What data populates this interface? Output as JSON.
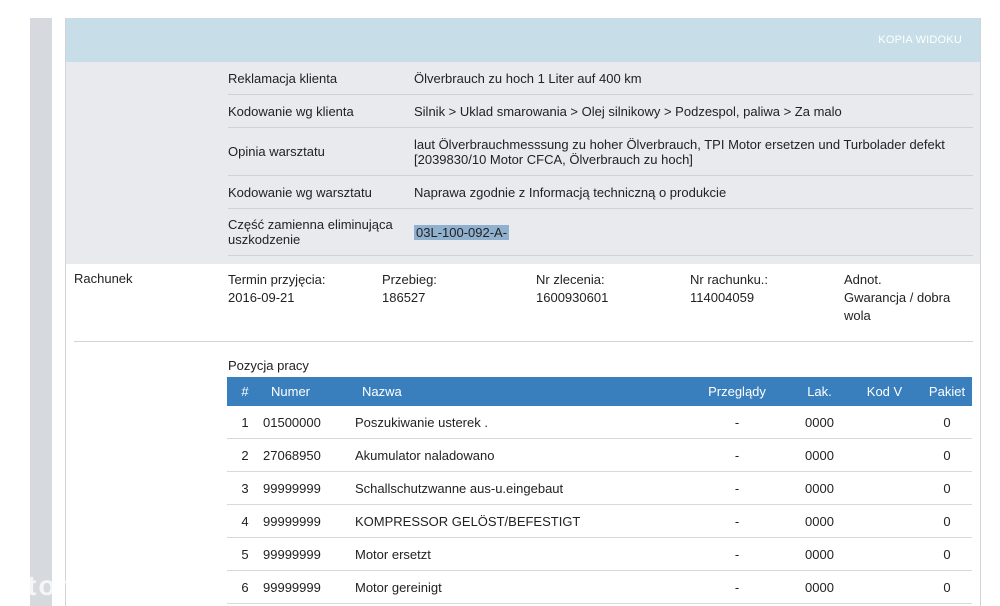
{
  "header": {
    "copy_view_label": "KOPIA WIDOKU"
  },
  "complaint": [
    {
      "label": "Reklamacja klienta",
      "value": "Ölverbrauch zu hoch 1 Liter auf 400 km"
    },
    {
      "label": "Kodowanie wg klienta",
      "value": "Silnik > Uklad smarowania > Olej silnikowy > Podzespol, paliwa > Za malo"
    },
    {
      "label": "Opinia warsztatu",
      "value": "laut Ölverbrauchmesssung zu hoher Ölverbrauch, TPI Motor ersetzen und Turbolader defekt [2039830/10 Motor CFCA, Ölverbrauch zu hoch]"
    },
    {
      "label": "Kodowanie wg warsztatu",
      "value": "Naprawa zgodnie z Informacją techniczną o produkcie"
    },
    {
      "label": "Część zamienna eliminująca uszkodzenie",
      "value": "03L-100-092-A-"
    }
  ],
  "invoice": {
    "section_label": "Rachunek",
    "fields": [
      {
        "label": "Termin przyjęcia:",
        "value": "2016-09-21"
      },
      {
        "label": "Przebieg:",
        "value": "186527"
      },
      {
        "label": "Nr zlecenia:",
        "value": "1600930601"
      },
      {
        "label": "Nr rachunku.:",
        "value": "114004059"
      },
      {
        "label": "Adnot.",
        "value": "Gwarancja / dobra wola"
      }
    ]
  },
  "work": {
    "title": "Pozycja pracy",
    "columns": [
      "#",
      "Numer",
      "Nazwa",
      "Przeglądy",
      "Lak.",
      "Kod V",
      "Pakiet"
    ],
    "rows": [
      {
        "idx": "1",
        "num": "01500000",
        "name": "Poszukiwanie usterek .",
        "prz": "-",
        "lak": "0000",
        "kod": "",
        "pak": "0"
      },
      {
        "idx": "2",
        "num": "27068950",
        "name": "Akumulator naladowano",
        "prz": "-",
        "lak": "0000",
        "kod": "",
        "pak": "0"
      },
      {
        "idx": "3",
        "num": "99999999",
        "name": "Schallschutzwanne aus-u.eingebaut",
        "prz": "-",
        "lak": "0000",
        "kod": "",
        "pak": "0"
      },
      {
        "idx": "4",
        "num": "99999999",
        "name": "KOMPRESSOR GELÖST/BEFESTIGT",
        "prz": "-",
        "lak": "0000",
        "kod": "",
        "pak": "0"
      },
      {
        "idx": "5",
        "num": "99999999",
        "name": "Motor ersetzt",
        "prz": "-",
        "lak": "0000",
        "kod": "",
        "pak": "0"
      },
      {
        "idx": "6",
        "num": "99999999",
        "name": "Motor gereinigt",
        "prz": "-",
        "lak": "0000",
        "kod": "",
        "pak": "0"
      }
    ]
  },
  "watermark": "otomoto"
}
